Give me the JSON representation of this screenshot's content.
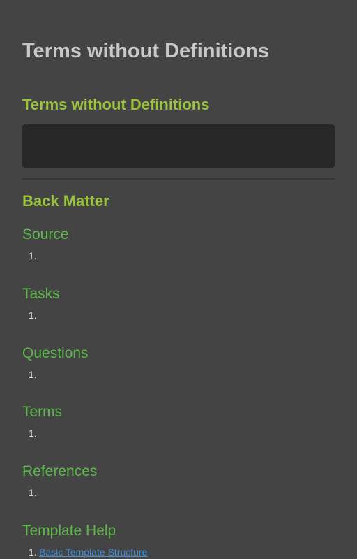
{
  "page": {
    "title": "Terms without Definitions"
  },
  "terms_section": {
    "title": "Terms without Definitions"
  },
  "back_matter": {
    "title": "Back Matter",
    "sections": [
      {
        "title": "Source",
        "items": [
          ""
        ]
      },
      {
        "title": "Tasks",
        "items": [
          ""
        ]
      },
      {
        "title": "Questions",
        "items": [
          ""
        ]
      },
      {
        "title": "Terms",
        "items": [
          ""
        ]
      },
      {
        "title": "References",
        "items": [
          ""
        ]
      },
      {
        "title": "Template Help",
        "items": [
          "Basic Template Structure"
        ]
      }
    ]
  },
  "colors": {
    "background": "#444444",
    "title": "#c8c8c8",
    "accent_green": "#99c33a",
    "section_green": "#5cb84a",
    "link_blue": "#3f8fdb",
    "empty_box": "#272727"
  }
}
